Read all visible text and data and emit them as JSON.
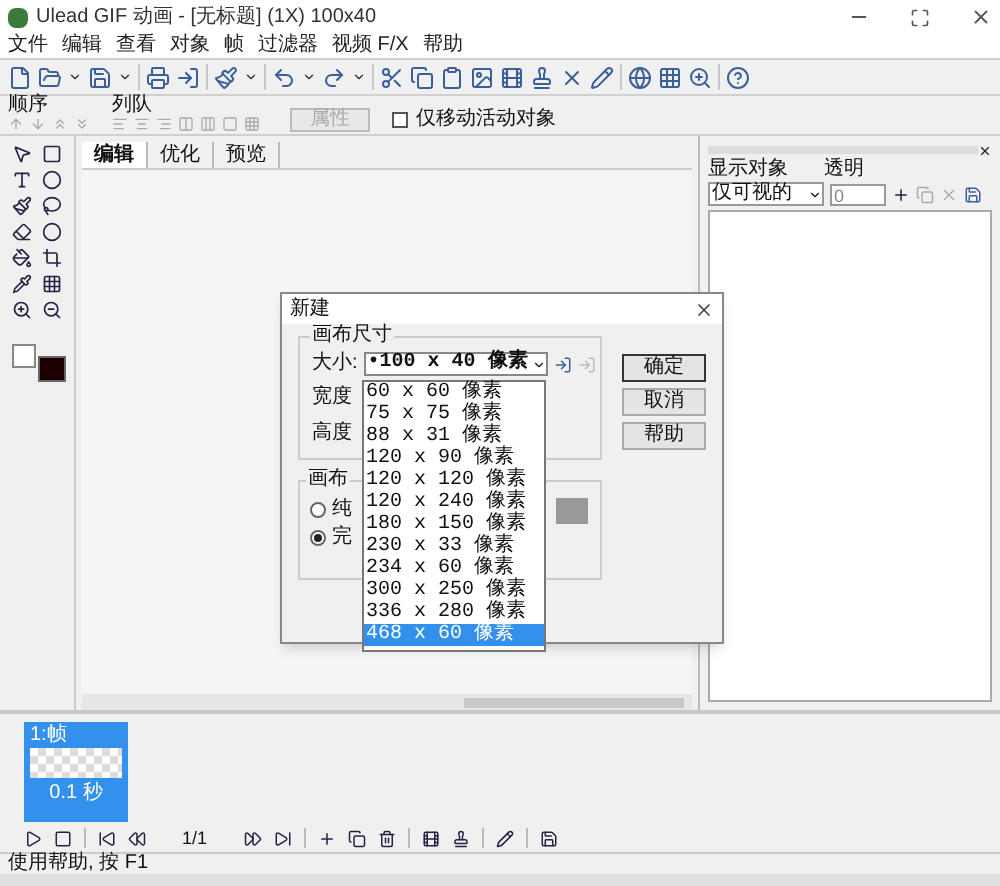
{
  "window": {
    "title": "Ulead GIF 动画 - [无标题] (1X) 100x40"
  },
  "menu": [
    "文件",
    "编辑",
    "查看",
    "对象",
    "帧",
    "过滤器",
    "视频 F/X",
    "帮助"
  ],
  "arrange_bar": {
    "order_label": "顺序",
    "queue_label": "列队",
    "properties_button": {
      "label": "属性",
      "disabled": true
    },
    "move_active_only": {
      "label": "仅移动活动对象",
      "checked": false
    }
  },
  "tabs": [
    {
      "label": "编辑",
      "selected": true
    },
    {
      "label": "优化",
      "selected": false
    },
    {
      "label": "预览",
      "selected": false
    }
  ],
  "object_panel": {
    "show_label": "显示对象",
    "show_value": "仅可视的",
    "opacity_label": "透明",
    "opacity_value": "0"
  },
  "dialog": {
    "title": "新建",
    "size_group": "画布尺寸",
    "size_label": "大小:",
    "size_value": "•100 x 40 像素",
    "width_label": "宽度",
    "height_label": "高度",
    "size_options": [
      {
        "label": "60 x 60 像素",
        "selected": false
      },
      {
        "label": "75 x 75 像素",
        "selected": false
      },
      {
        "label": "88 x 31 像素",
        "selected": false
      },
      {
        "label": "120 x 90 像素",
        "selected": false
      },
      {
        "label": "120 x 120 像素",
        "selected": false
      },
      {
        "label": "120 x 240 像素",
        "selected": false
      },
      {
        "label": "180 x 150 像素",
        "selected": false
      },
      {
        "label": "230 x 33 像素",
        "selected": false
      },
      {
        "label": "234 x 60 像素",
        "selected": false
      },
      {
        "label": "300 x 250 像素",
        "selected": false
      },
      {
        "label": "336 x 280 像素",
        "selected": false
      },
      {
        "label": "468 x 60 像素",
        "selected": true
      }
    ],
    "appearance_group": "画布",
    "radios": [
      {
        "label": "纯",
        "selected": false
      },
      {
        "label": "完",
        "selected": true
      }
    ],
    "buttons": [
      "确定",
      "取消",
      "帮助"
    ]
  },
  "frames": [
    {
      "label": "1:帧",
      "delay": "0.1 秒",
      "selected": true
    }
  ],
  "frame_counter": "1/1",
  "status_bar": "使用帮助, 按 F1"
}
